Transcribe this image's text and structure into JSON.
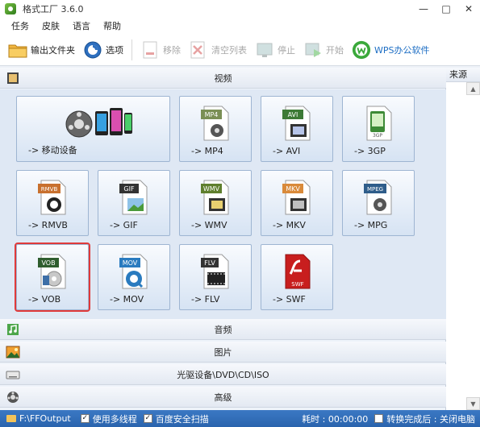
{
  "window": {
    "title": "格式工厂 3.6.0",
    "minimize": "—",
    "maximize": "□",
    "close": "✕"
  },
  "menu": [
    "任务",
    "皮肤",
    "语言",
    "帮助"
  ],
  "toolbar": {
    "output_folder": "输出文件夹",
    "options": "选项",
    "remove": "移除",
    "clear_list": "清空列表",
    "stop": "停止",
    "start": "开始",
    "wps": "WPS办公软件"
  },
  "sections": {
    "video": "视频",
    "audio": "音频",
    "image": "图片",
    "rom": "光驱设备\\DVD\\CD\\ISO",
    "advanced": "高级"
  },
  "tiles": [
    {
      "label": "-> 移动设备",
      "icon": "mobile-device-icon",
      "badge": ""
    },
    {
      "label": "-> MP4",
      "icon": "mp4-file-icon",
      "badge": "MP4"
    },
    {
      "label": "-> AVI",
      "icon": "avi-file-icon",
      "badge": "AVI"
    },
    {
      "label": "-> 3GP",
      "icon": "3gp-file-icon",
      "badge": "3GP"
    },
    {
      "label": "-> RMVB",
      "icon": "rmvb-file-icon",
      "badge": "RMVB"
    },
    {
      "label": "-> GIF",
      "icon": "gif-file-icon",
      "badge": "GIF"
    },
    {
      "label": "-> WMV",
      "icon": "wmv-file-icon",
      "badge": "WMV"
    },
    {
      "label": "-> MKV",
      "icon": "mkv-file-icon",
      "badge": "MKV"
    },
    {
      "label": "-> MPG",
      "icon": "mpg-file-icon",
      "badge": "MPEG"
    },
    {
      "label": "-> VOB",
      "icon": "vob-file-icon",
      "badge": "VOB"
    },
    {
      "label": "-> MOV",
      "icon": "mov-file-icon",
      "badge": "MOV"
    },
    {
      "label": "-> FLV",
      "icon": "flv-file-icon",
      "badge": "FLV"
    },
    {
      "label": "-> SWF",
      "icon": "swf-file-icon",
      "badge": "SWF"
    }
  ],
  "right_panel": {
    "header": "来源"
  },
  "status": {
    "output_path": "F:\\FFOutput",
    "multithread": "使用多线程",
    "baidu_scan": "百度安全扫描",
    "elapsed": "耗时 : 00:00:00",
    "after_done": "转换完成后 : 关闭电脑"
  },
  "colors": {
    "accent": "#2a64ad",
    "selected_outline": "#e03a3a"
  }
}
